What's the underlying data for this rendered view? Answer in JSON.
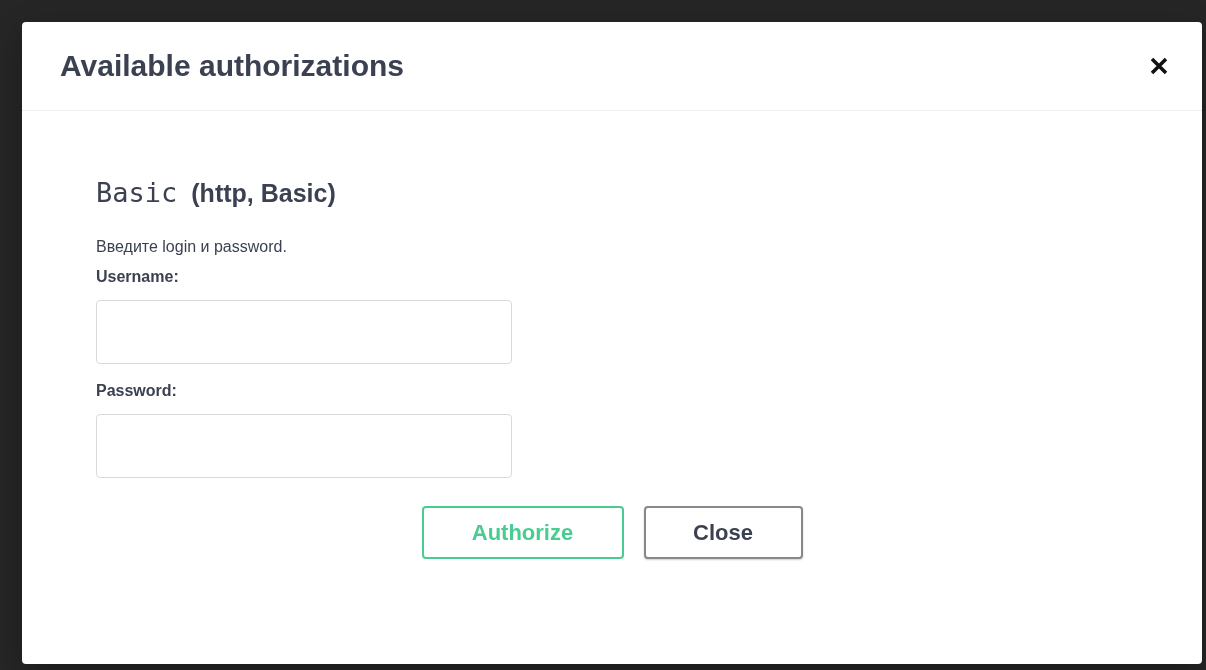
{
  "modal": {
    "title": "Available authorizations"
  },
  "scheme": {
    "name": "Basic",
    "meta": "(http, Basic)",
    "description": "Введите login и password."
  },
  "fields": [
    {
      "label": "Username:"
    },
    {
      "label": "Password:"
    }
  ],
  "buttons": [
    {
      "label": "Authorize",
      "kind": "authorize"
    },
    {
      "label": "Close",
      "kind": "close"
    }
  ]
}
